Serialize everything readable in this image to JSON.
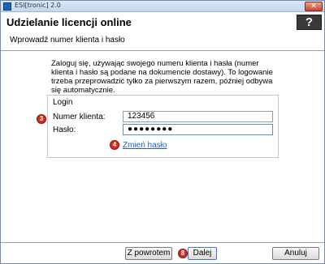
{
  "window": {
    "title": "ESI[tronic] 2.0",
    "close_label": "✕"
  },
  "header": {
    "title": "Udzielanie licencji online",
    "subtitle": "Wprowadź numer klienta i hasło",
    "help_label": "?"
  },
  "content": {
    "intro": "Zaloguj się, używając swojego numeru klienta i hasła (numer klienta i hasło są podane na dokumencie dostawy). To logowanie trzeba przeprowadzić tylko za pierwszym razem, później odbywa się automatycznie."
  },
  "login": {
    "group_label": "Login",
    "number_label": "Numer klienta:",
    "number_value": "123456",
    "password_label": "Hasło:",
    "password_value": "●●●●●●●●",
    "change_password_link": "Zmień hasło"
  },
  "badges": {
    "b3": "3",
    "b4": "4",
    "b8": "8"
  },
  "footer": {
    "back_label": "Z powrotem",
    "next_label": "Dalej",
    "cancel_label": "Anuluj"
  }
}
